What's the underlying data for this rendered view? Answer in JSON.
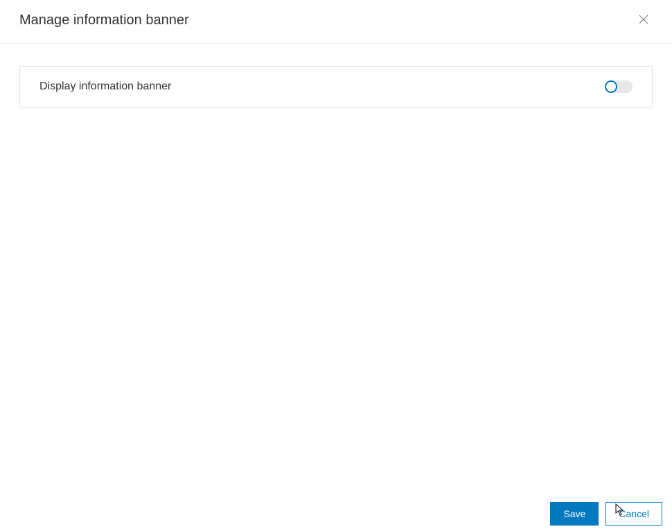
{
  "header": {
    "title": "Manage information banner"
  },
  "panel": {
    "display_banner_label": "Display information banner",
    "toggle_state": "off"
  },
  "footer": {
    "save_label": "Save",
    "cancel_label": "Cancel"
  }
}
